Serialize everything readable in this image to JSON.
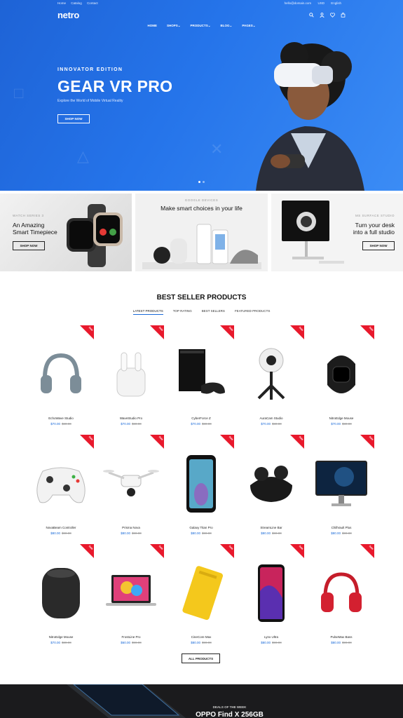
{
  "header": {
    "top_links": [
      "Home",
      "Catalog",
      "Contact"
    ],
    "email": "hello@domain.com",
    "currency": "USD",
    "language": "English",
    "logo": "netro",
    "menu": [
      "HOME",
      "SHOPS",
      "PRODUCTS",
      "BLOG",
      "PAGES"
    ],
    "icons": [
      "search-icon",
      "user-icon",
      "heart-icon",
      "cart-icon"
    ]
  },
  "hero": {
    "subtitle": "INNOVATOR EDITION",
    "title": "GEAR VR PRO",
    "description": "Explore the World of Mobile Virtual Reality",
    "button": "SHOP NOW"
  },
  "banners": [
    {
      "subtitle": "WATCH SERIES 3",
      "title_line1": "An Amazing",
      "title_line2": "Smart Timepiece",
      "button": "SHOP NOW"
    },
    {
      "subtitle": "GOOGLE DEVICES",
      "title_line1": "Make smart choices in your life"
    },
    {
      "subtitle": "MS SURFACE STUDIO",
      "title_line1": "Turn your desk",
      "title_line2": "into a full studio",
      "button": "SHOP NOW"
    }
  ],
  "products_section": {
    "title": "BEST SELLER PRODUCTS",
    "tabs": [
      "LATEST PRODUCTS",
      "TOP RATING",
      "BEST SELLERS",
      "FEATURED PRODUCTS"
    ],
    "sale_badge": "Sale",
    "products": [
      {
        "name": "EchoWave Studio",
        "price": "$70.00",
        "old": "$80.00",
        "icon": "headphones"
      },
      {
        "name": "WaveStudio Pro",
        "price": "$70.00",
        "old": "$80.00",
        "icon": "earbuds-case"
      },
      {
        "name": "CyberForce Z",
        "price": "$70.00",
        "old": "$80.00",
        "icon": "console"
      },
      {
        "name": "AuraCam Studio",
        "price": "$70.00",
        "old": "$80.00",
        "icon": "camera-360"
      },
      {
        "name": "NitroEdge Mouse",
        "price": "$70.00",
        "old": "$80.00",
        "icon": "fitness-band"
      },
      {
        "name": "NovaBeam Controller",
        "price": "$80.00",
        "old": "$90.00",
        "icon": "gamepad"
      },
      {
        "name": "Prisma Nova",
        "price": "$80.00",
        "old": "$90.00",
        "icon": "drone"
      },
      {
        "name": "Galaxy Titan Pro",
        "price": "$80.00",
        "old": "$90.00",
        "icon": "smartphone"
      },
      {
        "name": "StreamLine Bar",
        "price": "$80.00",
        "old": "$90.00",
        "icon": "wireless-earbuds"
      },
      {
        "name": "ChillVault Plus",
        "price": "$80.00",
        "old": "$90.00",
        "icon": "monitor"
      },
      {
        "name": "NitroEdge Mouse",
        "price": "$70.00",
        "old": "$80.00",
        "icon": "smart-speaker"
      },
      {
        "name": "FrostLine Pro",
        "price": "$60.00",
        "old": "$90.00",
        "icon": "laptop"
      },
      {
        "name": "CineCore Max",
        "price": "$80.00",
        "old": "$90.00",
        "icon": "hard-drive"
      },
      {
        "name": "Lynx Ultra",
        "price": "$80.00",
        "old": "$90.00",
        "icon": "smartphone-red"
      },
      {
        "name": "PulseMax Bass",
        "price": "$80.00",
        "old": "$90.00",
        "icon": "red-headphones"
      }
    ],
    "all_button": "ALL PRODUCTS"
  },
  "deal": {
    "subtitle": "DEALS OF THE WEEK",
    "title": "OPPO Find X 256GB"
  },
  "colors": {
    "hero_blue": "#2574ea",
    "sale_red": "#e8192c",
    "price_blue": "#1a6ad8"
  }
}
